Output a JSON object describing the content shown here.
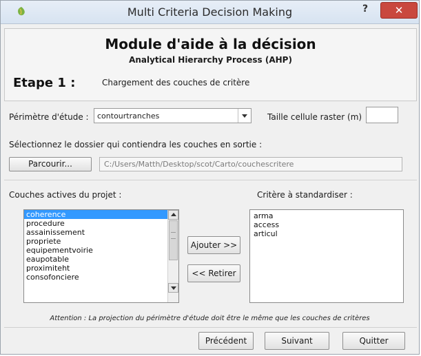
{
  "window": {
    "title": "Multi Criteria Decision Making",
    "help_label": "?",
    "close_label": "✕"
  },
  "header": {
    "module_title": "Module d'aide à la décision",
    "method_subtitle": "Analytical Hierarchy Process (AHP)",
    "step_label": "Etape 1 :",
    "step_description": "Chargement des couches de critère"
  },
  "form": {
    "perimeter_label": "Périmètre d'étude :",
    "perimeter_value": "contourtranches",
    "cell_size_label": "Taille cellule raster (m)",
    "cell_size_value": "",
    "output_folder_label": "Sélectionnez le dossier qui contiendra les couches en sortie :",
    "browse_label": "Parcourir...",
    "output_path": "C:/Users/Matth/Desktop/scot/Carto/couchescritere"
  },
  "layers": {
    "active_label": "Couches actives du projet :",
    "active_items": [
      "coherence",
      "procedure",
      "assainissement",
      "propriete",
      "equipementvoirie",
      "eaupotable",
      "proximiteht",
      "consofonciere"
    ],
    "selected_item": "coherence",
    "criteria_label": "Critère à standardiser :",
    "criteria_items": [
      "arma",
      "access",
      "articul"
    ],
    "add_label": "Ajouter >>",
    "remove_label": "<< Retirer"
  },
  "notice": "Attention : La projection du périmètre d'étude doit être le même que les couches de critères",
  "footer": {
    "previous_label": "Précédent",
    "next_label": "Suivant",
    "quit_label": "Quitter"
  }
}
